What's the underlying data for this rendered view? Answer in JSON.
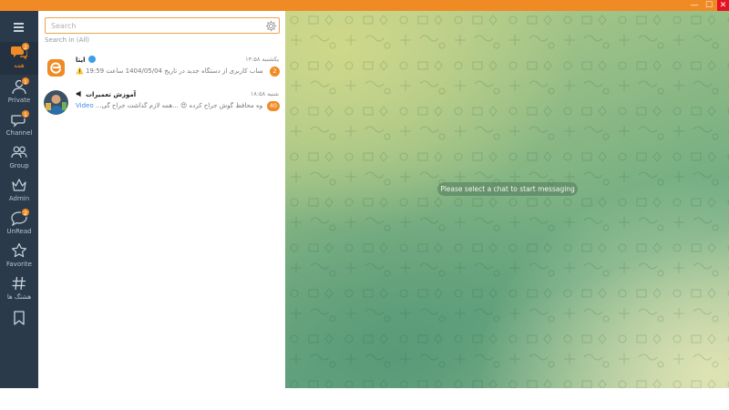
{
  "window": {
    "controls": {
      "minimize": "—",
      "maximize": "☐",
      "close": "✕"
    },
    "accent_color": "#f08a24",
    "close_color": "#e81123"
  },
  "sidebar": {
    "background": "#2b3a4a",
    "items": [
      {
        "id": "all",
        "label": "همه",
        "icon": "chat-bubbles-icon",
        "badge": "2",
        "active": true
      },
      {
        "id": "private",
        "label": "Private",
        "icon": "person-icon",
        "badge": "1"
      },
      {
        "id": "channel",
        "label": "Channel",
        "icon": "megaphone-icon",
        "badge": "1"
      },
      {
        "id": "group",
        "label": "Group",
        "icon": "group-icon",
        "badge": ""
      },
      {
        "id": "admin",
        "label": "Admin",
        "icon": "crown-icon",
        "badge": ""
      },
      {
        "id": "unread",
        "label": "UnRead",
        "icon": "unread-chat-icon",
        "badge": "2"
      },
      {
        "id": "favorite",
        "label": "Favorite",
        "icon": "star-icon",
        "badge": ""
      },
      {
        "id": "hashtag",
        "label": "هشتگ ها",
        "icon": "hashtag-icon",
        "badge": ""
      },
      {
        "id": "saved",
        "label": "",
        "icon": "bookmark-icon",
        "badge": ""
      }
    ]
  },
  "chatlist": {
    "search": {
      "placeholder": "Search"
    },
    "search_in": "Search in (All)",
    "chats": [
      {
        "name": "ایتا",
        "verified": true,
        "time": "یکشنبه ۱۴:۵۸",
        "preview": "⚠️ ورود به حساب کاربری از دستگاه جدید در تاریخ 1404/05/04 ساعت 19:59",
        "badge": "2",
        "avatar": "eitaa-logo"
      },
      {
        "name": "آموزش تعمیرات",
        "channel": true,
        "time": "شنبه ۱۸:۵۸",
        "preview_prefix": "Video",
        "preview": " ...شیوه محافظ گوش جراح کرده 😍 ...همه لازم گذاشت جراح گی 😏",
        "badge": "40",
        "avatar": "repair-channel-photo"
      }
    ]
  },
  "chat_area": {
    "placeholder": "Please select a chat to start messaging"
  }
}
